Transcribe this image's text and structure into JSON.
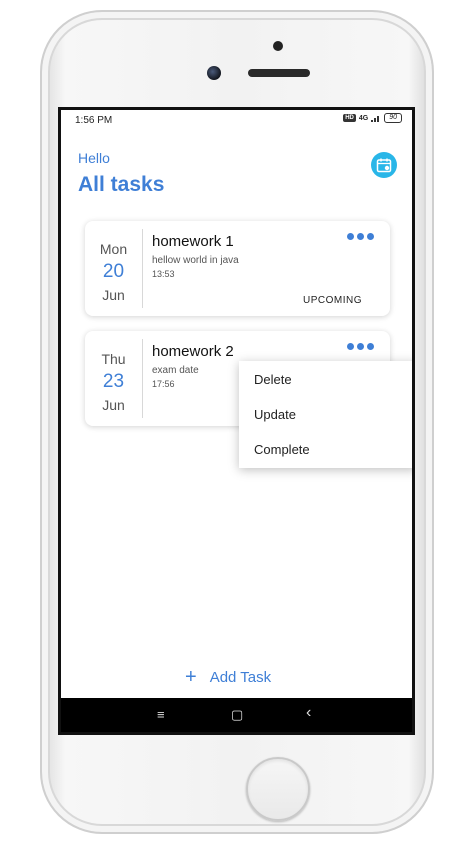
{
  "status_bar": {
    "time": "1:56 PM",
    "hd_badge": "HD",
    "signal": "4G",
    "battery": "90"
  },
  "header": {
    "greeting": "Hello",
    "title": "All tasks",
    "calendar_icon": "calendar-icon"
  },
  "tasks": [
    {
      "weekday": "Mon",
      "day": "20",
      "month": "Jun",
      "name": "homework 1",
      "description": "hellow world in java",
      "time": "13:53",
      "status": "UPCOMING"
    },
    {
      "weekday": "Thu",
      "day": "23",
      "month": "Jun",
      "name": "homework 2",
      "description": "exam date",
      "time": "17:56",
      "status": ""
    }
  ],
  "context_menu": {
    "items": [
      "Delete",
      "Update",
      "Complete"
    ]
  },
  "add_task": {
    "icon": "+",
    "label": "Add Task"
  },
  "nav_bar": {
    "menu_icon": "≡",
    "home_icon": "▢",
    "back_icon": "‹"
  },
  "colors": {
    "accent": "#3f7fd6",
    "calendar_button": "#29b6e8"
  }
}
